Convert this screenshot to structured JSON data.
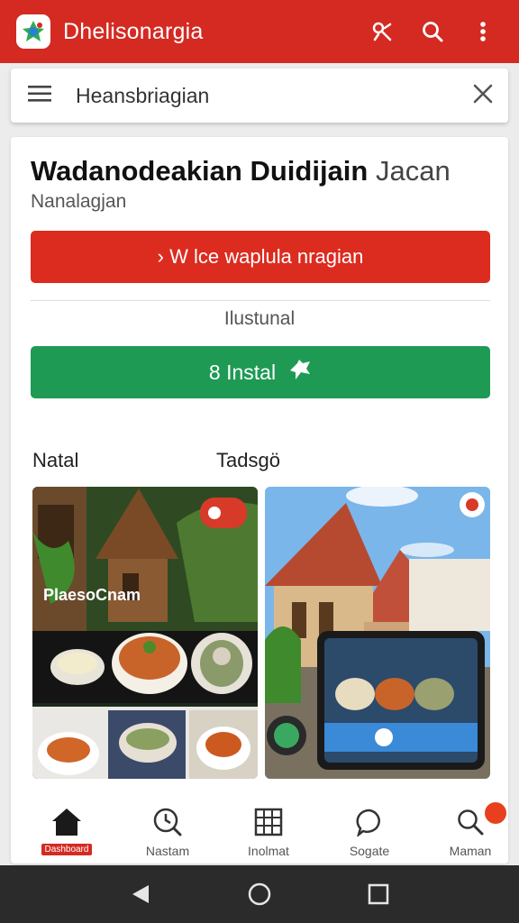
{
  "colors": {
    "primary": "#d42a22",
    "green": "#1e9a54",
    "accent_dot": "#e8401e"
  },
  "appbar": {
    "title": "Dhelisonargia",
    "icons": [
      "app-logo",
      "pin-icon",
      "search-icon",
      "more-vert-icon"
    ]
  },
  "search": {
    "text": "Heansbriagian",
    "icons": [
      "menu-icon",
      "close-icon"
    ]
  },
  "card": {
    "title_bold": "Wadanodeakian Duidijain",
    "title_light": "Jacan",
    "subtitle": "Nanalagjan",
    "primary_button": "› W lce waplula nragian",
    "mid_label": "Ilustunal",
    "install_button": "8 Instal"
  },
  "gallery": {
    "left_label": "Natal",
    "right_label": "Tadsgö",
    "left_tile_caption": "PlaesoCnam"
  },
  "bottom_nav": [
    {
      "label": "Dashboard",
      "icon": "home-icon",
      "active": true
    },
    {
      "label": "Nastam",
      "icon": "clock-search-icon",
      "active": false
    },
    {
      "label": "Inolmat",
      "icon": "grid-icon",
      "active": false
    },
    {
      "label": "Sogate",
      "icon": "chat-icon",
      "active": false
    },
    {
      "label": "Maman",
      "icon": "search-icon",
      "active": false,
      "badge": true
    }
  ],
  "system_nav": [
    "back-icon",
    "home-circle-icon",
    "recents-icon"
  ]
}
